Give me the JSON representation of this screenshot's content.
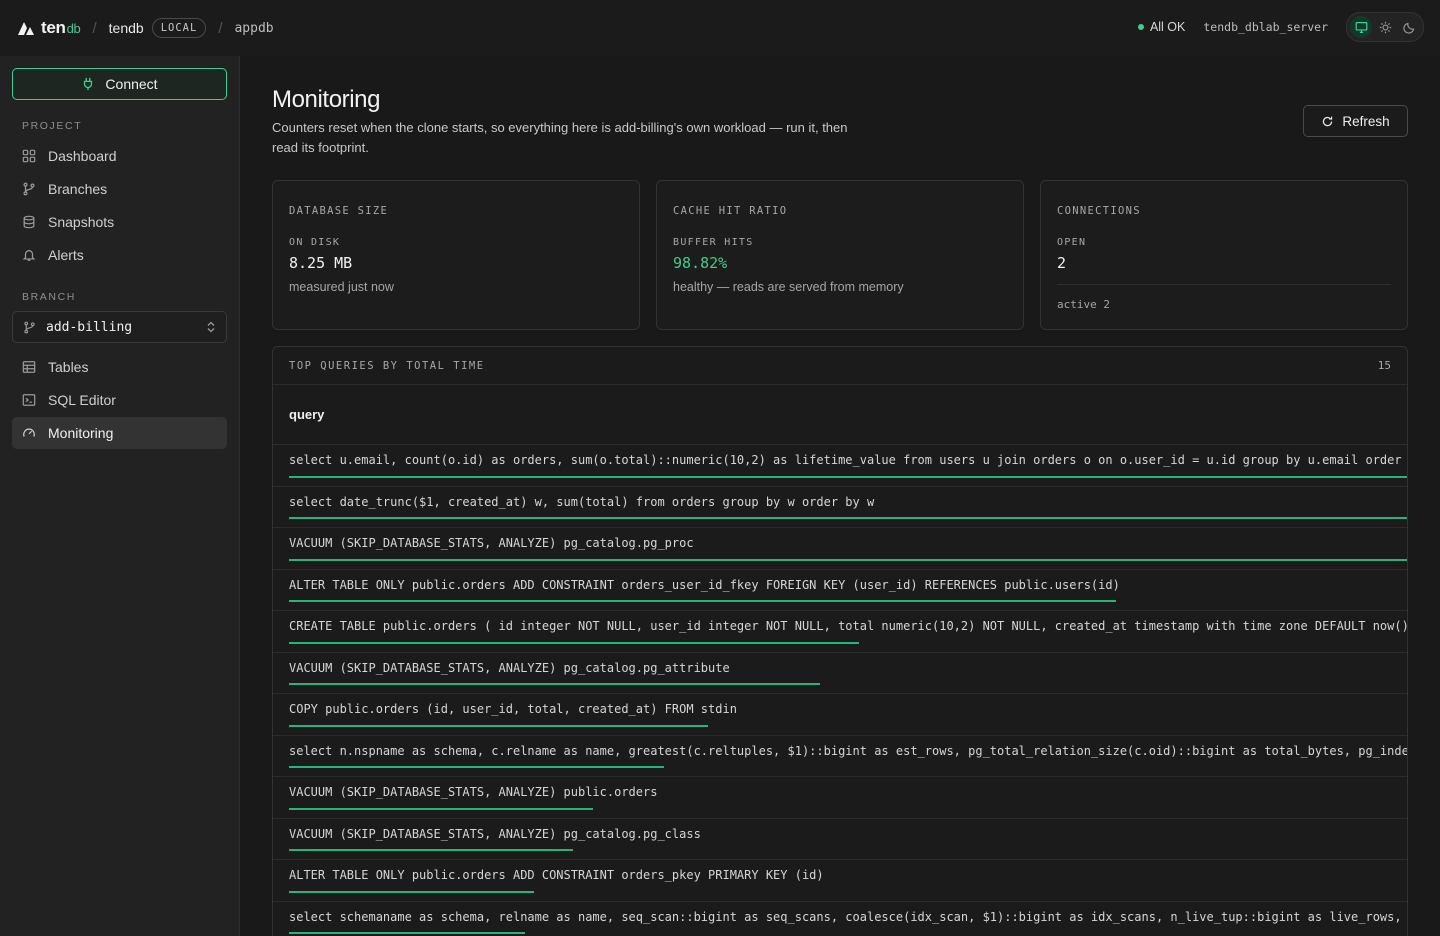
{
  "brand": {
    "name": "ten",
    "suffix": "db"
  },
  "breadcrumb": {
    "project": "tendb",
    "env_badge": "LOCAL",
    "database": "appdb"
  },
  "status": {
    "label": "All OK",
    "server": "tendb_dblab_server"
  },
  "colors": {
    "accent": "#3ecf8e",
    "background": "#191919",
    "sidebar": "#222222"
  },
  "sidebar": {
    "connect_label": "Connect",
    "project_label": "PROJECT",
    "project_items": [
      {
        "label": "Dashboard",
        "icon": "grid-icon"
      },
      {
        "label": "Branches",
        "icon": "git-branch-icon"
      },
      {
        "label": "Snapshots",
        "icon": "database-icon"
      },
      {
        "label": "Alerts",
        "icon": "bell-icon"
      }
    ],
    "branch_label": "BRANCH",
    "branch_selected": "add-billing",
    "branch_items": [
      {
        "label": "Tables",
        "icon": "table-icon"
      },
      {
        "label": "SQL Editor",
        "icon": "terminal-icon"
      },
      {
        "label": "Monitoring",
        "icon": "gauge-icon",
        "active": true
      }
    ]
  },
  "page": {
    "title": "Monitoring",
    "description": "Counters reset when the clone starts, so everything here is add-billing's own workload — run it, then read its footprint.",
    "refresh_label": "Refresh"
  },
  "cards": {
    "size": {
      "title": "DATABASE SIZE",
      "sub": "ON DISK",
      "value": "8.25 MB",
      "note": "measured just now"
    },
    "cache": {
      "title": "CACHE HIT RATIO",
      "sub": "BUFFER HITS",
      "value": "98.82%",
      "note": "healthy — reads are served from memory"
    },
    "connections": {
      "title": "CONNECTIONS",
      "sub": "OPEN",
      "value": "2",
      "foot": "active 2"
    }
  },
  "queries": {
    "title": "TOP QUERIES BY TOTAL TIME",
    "count": "15",
    "column": "query",
    "rows": [
      {
        "text": "select u.email, count(o.id) as orders, sum(o.total)::numeric(10,2) as lifetime_value from users u join orders o on o.user_id = u.id group by u.email order",
        "share": 1.0
      },
      {
        "text": "select date_trunc($1, created_at) w, sum(total) from orders group by w order by w",
        "share": 1.0
      },
      {
        "text": "VACUUM (SKIP_DATABASE_STATS, ANALYZE) pg_catalog.pg_proc",
        "share": 1.0
      },
      {
        "text": "ALTER TABLE ONLY public.orders ADD CONSTRAINT orders_user_id_fkey FOREIGN KEY (user_id) REFERENCES public.users(id)",
        "share": 0.74
      },
      {
        "text": "CREATE TABLE public.orders ( id integer NOT NULL, user_id integer NOT NULL, total numeric(10,2) NOT NULL, created_at timestamp with time zone DEFAULT now()",
        "share": 0.51
      },
      {
        "text": "VACUUM (SKIP_DATABASE_STATS, ANALYZE) pg_catalog.pg_attribute",
        "share": 0.475
      },
      {
        "text": "COPY public.orders (id, user_id, total, created_at) FROM stdin",
        "share": 0.375
      },
      {
        "text": "select n.nspname as schema, c.relname as name, greatest(c.reltuples, $1)::bigint as est_rows, pg_total_relation_size(c.oid)::bigint as total_bytes, pg_inde",
        "share": 0.335
      },
      {
        "text": "VACUUM (SKIP_DATABASE_STATS, ANALYZE) public.orders",
        "share": 0.272
      },
      {
        "text": "VACUUM (SKIP_DATABASE_STATS, ANALYZE) pg_catalog.pg_class",
        "share": 0.254
      },
      {
        "text": "ALTER TABLE ONLY public.orders ADD CONSTRAINT orders_pkey PRIMARY KEY (id)",
        "share": 0.219
      },
      {
        "text": "select schemaname as schema, relname as name, seq_scan::bigint as seq_scans, coalesce(idx_scan, $1)::bigint as idx_scans, n_live_tup::bigint as live_rows,",
        "share": 0.211
      }
    ]
  }
}
